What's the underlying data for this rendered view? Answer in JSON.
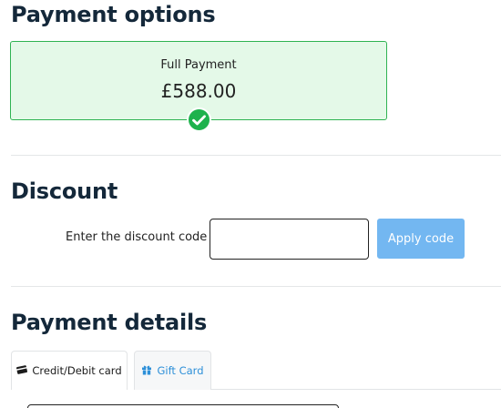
{
  "sections": {
    "payment_options_title": "Payment options",
    "discount_title": "Discount",
    "payment_details_title": "Payment details"
  },
  "payment_option": {
    "label": "Full Payment",
    "price": "£588.00",
    "selected": true
  },
  "discount": {
    "label": "Enter the discount code",
    "input_value": "",
    "apply_label": "Apply code"
  },
  "tabs": [
    {
      "label": "Credit/Debit card",
      "icon": "credit-card-icon",
      "active": true
    },
    {
      "label": "Gift Card",
      "icon": "gift-icon",
      "active": false
    }
  ],
  "colors": {
    "selected_card_bg": "#e4f9e8",
    "selected_border": "#2fb352",
    "check_green": "#1eb24d",
    "apply_button_bg": "#73b7f1",
    "link_blue": "#2d8fd8",
    "heading": "#14283a"
  }
}
